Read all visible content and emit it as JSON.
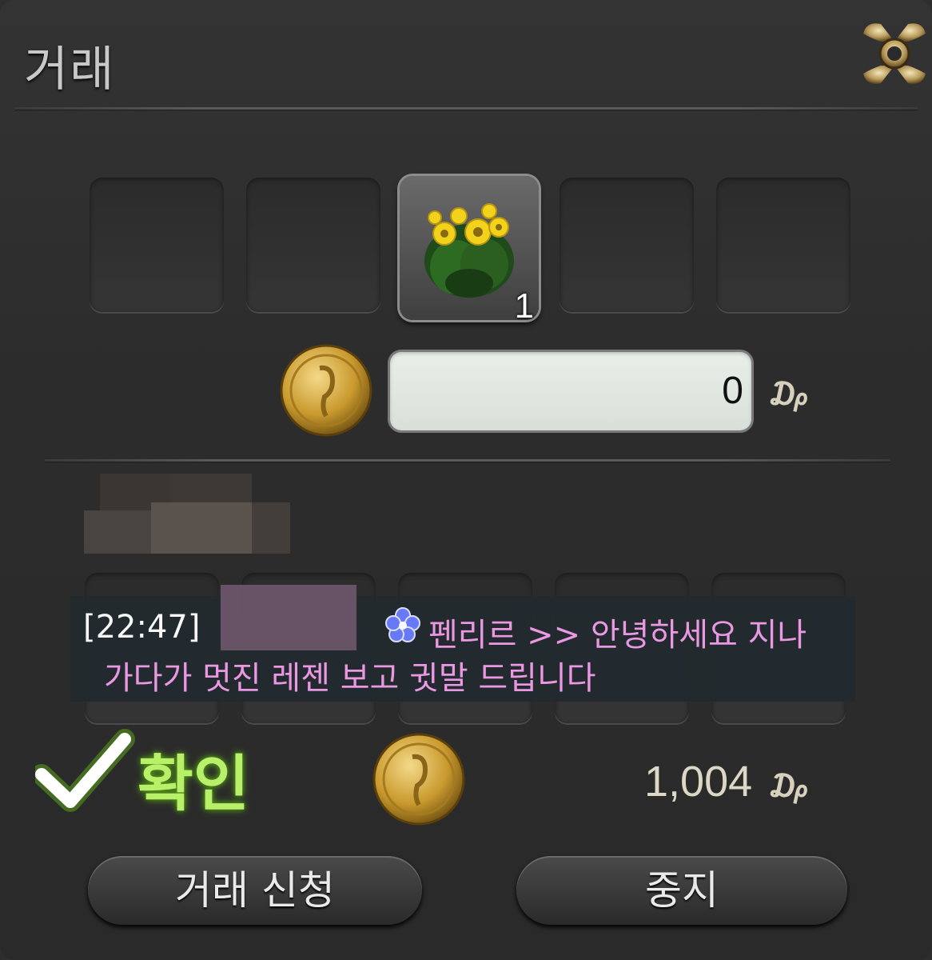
{
  "window": {
    "title": "거래"
  },
  "offer": {
    "slots": [
      {
        "filled": false
      },
      {
        "filled": false
      },
      {
        "filled": true,
        "icon": "yellow-flower-plant-icon",
        "quantity": "1"
      },
      {
        "filled": false
      },
      {
        "filled": false
      }
    ],
    "gil_value": "0",
    "gil_unit": "₯"
  },
  "chat": {
    "timestamp": "[22:47]",
    "message_line1": "펜리르 >> 안녕하세요 지나",
    "message_line2": "가다가 멋진 레젠 보고 귓말 드립니다",
    "world_icon": "blue-flower-icon"
  },
  "partner": {
    "confirm_label": "확인",
    "gil_total": "1,004",
    "gil_unit": "₯"
  },
  "buttons": {
    "trade_request": "거래 신청",
    "cancel": "중지"
  },
  "colors": {
    "confirm_green": "#b8f06a",
    "chat_pink": "#f19ce8"
  }
}
